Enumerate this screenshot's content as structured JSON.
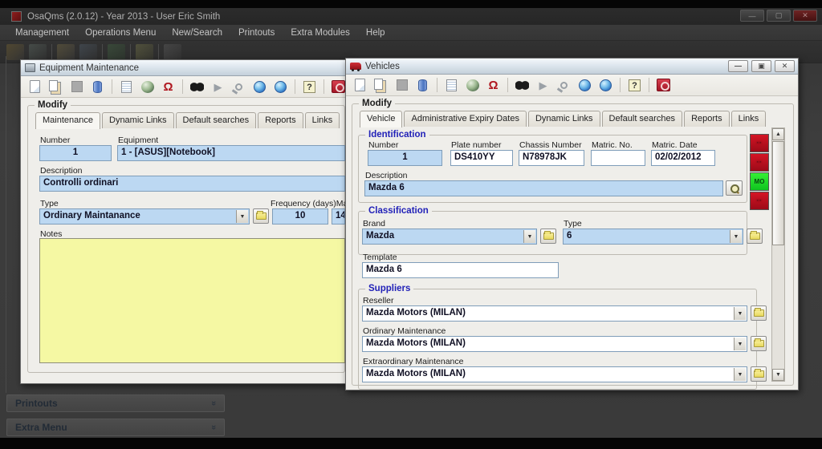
{
  "main_window": {
    "title": "OsaQms (2.0.12) - Year 2013 - User Eric Smith",
    "menu": [
      "Management",
      "Operations Menu",
      "New/Search",
      "Printouts",
      "Extra Modules",
      "Help"
    ],
    "window_buttons": [
      "minimize",
      "maximize",
      "close"
    ],
    "toolbar_icons": [
      "app-tool-1",
      "app-tool-2",
      "app-tool-3",
      "app-tool-4",
      "app-tool-5",
      "app-tool-6",
      "app-tool-7"
    ],
    "side_panels": [
      {
        "label": "Printouts",
        "chevron": "»"
      },
      {
        "label": "Extra Menu",
        "chevron": "»"
      }
    ]
  },
  "toolbar": {
    "icon_groups": [
      [
        "new-document",
        "copy",
        "save",
        "database"
      ],
      [
        "print-preview",
        "world-refresh",
        "omega"
      ],
      [
        "binoculars",
        "play",
        "magnifier",
        "globe-previous",
        "globe-next"
      ],
      [
        "help"
      ],
      [
        "exit"
      ]
    ]
  },
  "equipment_window": {
    "title": "Equipment Maintenance",
    "group_title": "Modify",
    "tabs": [
      "Maintenance",
      "Dynamic Links",
      "Default searches",
      "Reports",
      "Links"
    ],
    "active_tab": 0,
    "number_label": "Number",
    "number_value": "1",
    "equipment_label": "Equipment",
    "equipment_value": "1 - [ASUS][Notebook]",
    "description_label": "Description",
    "description_value": "Controlli ordinari",
    "type_label": "Type",
    "type_value": "Ordinary Maintanance",
    "frequency_label": "Frequency (days)",
    "frequency_value": "10",
    "clipped_label": "Ma",
    "clipped_value": "14",
    "notes_label": "Notes",
    "notes_value": ""
  },
  "vehicles_window": {
    "title": "Vehicles",
    "group_title": "Modify",
    "tabs": [
      "Vehicle",
      "Administrative Expiry Dates",
      "Dynamic Links",
      "Default searches",
      "Reports",
      "Links"
    ],
    "active_tab": 0,
    "identification": {
      "title": "Identification",
      "number_label": "Number",
      "number_value": "1",
      "plate_label": "Plate number",
      "plate_value": "DS410YY",
      "chassis_label": "Chassis Number",
      "chassis_value": "N78978JK",
      "matric_no_label": "Matric. No.",
      "matric_no_value": "",
      "matric_date_label": "Matric. Date",
      "matric_date_value": "02/02/2012",
      "description_label": "Description",
      "description_value": "Mazda 6"
    },
    "classification": {
      "title": "Classification",
      "brand_label": "Brand",
      "brand_value": "Mazda",
      "type_label": "Type",
      "type_value": "6",
      "template_label": "Template",
      "template_value": "Mazda 6"
    },
    "suppliers": {
      "title": "Suppliers",
      "reseller_label": "Reseller",
      "reseller_value": "Mazda Motors (MILAN)",
      "ordinary_label": "Ordinary Maintenance",
      "ordinary_value": "Mazda Motors (MILAN)",
      "extraordinary_label": "Extraordinary Maintenance",
      "extraordinary_value": "Mazda Motors (MILAN)"
    },
    "badges": [
      {
        "label": "",
        "color": "red"
      },
      {
        "label": "",
        "color": "red"
      },
      {
        "label": "MO",
        "color": "green"
      },
      {
        "label": "",
        "color": "red"
      }
    ]
  },
  "colors": {
    "field_blue": "#bcd8f2",
    "notes_yellow": "#f5f8a3",
    "badge_red": "#c41020",
    "badge_green": "#1fd42a",
    "section_label_blue": "#2222b8"
  }
}
